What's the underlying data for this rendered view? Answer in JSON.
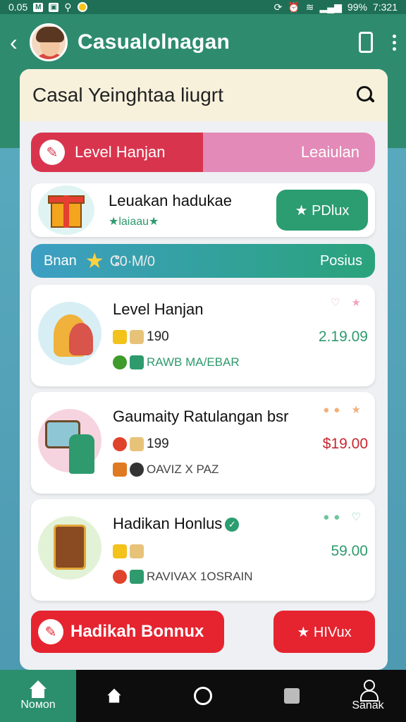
{
  "status_bar": {
    "time_left": "0.05",
    "battery": "99%",
    "clock": "7:321"
  },
  "app": {
    "title": "Casualolnagan",
    "accent": "#2b9d71",
    "danger": "#e52430"
  },
  "search": {
    "placeholder": "Casal Yeinghtaa liugrt",
    "icon": "search-icon"
  },
  "level_bar": {
    "label": "Level Hanjan",
    "right_label": "Leaiulan",
    "progress": 0.5
  },
  "promo": {
    "title": "Leuakan hadukae",
    "subtitle": "★laiaau★",
    "button": "★ PDlux"
  },
  "bonus_bar": {
    "left": "Bnan",
    "code": "ⵛ0·Ꮇ/0",
    "right": "Posius"
  },
  "items": [
    {
      "name": "Level Hanjan",
      "count": "190",
      "tag": "RAWB MA/EBAR",
      "price": "2.19.09",
      "price_color": "#2e9a6e",
      "marks": "♡ ★",
      "icon": "kids-icon"
    },
    {
      "name": "Gaumaity Ratulangan bsr",
      "count": "199",
      "tag": "OAVIZ X PAZ",
      "price": "$19.00",
      "price_color": "#c8262f",
      "marks": "●● ★",
      "icon": "tablet-icon"
    },
    {
      "name": "Hadikan Honlus",
      "count": "",
      "tag": "RAVIVAX 1OSRAIN",
      "price": "59.00",
      "price_color": "#2e9a6e",
      "marks": "●● ♡",
      "icon": "chest-icon"
    }
  ],
  "bottom": {
    "left_button": "Hadikah Bonnux",
    "right_button": "★ HIVux"
  },
  "nav": [
    "Noмon",
    "",
    "",
    "",
    "Sanak"
  ]
}
